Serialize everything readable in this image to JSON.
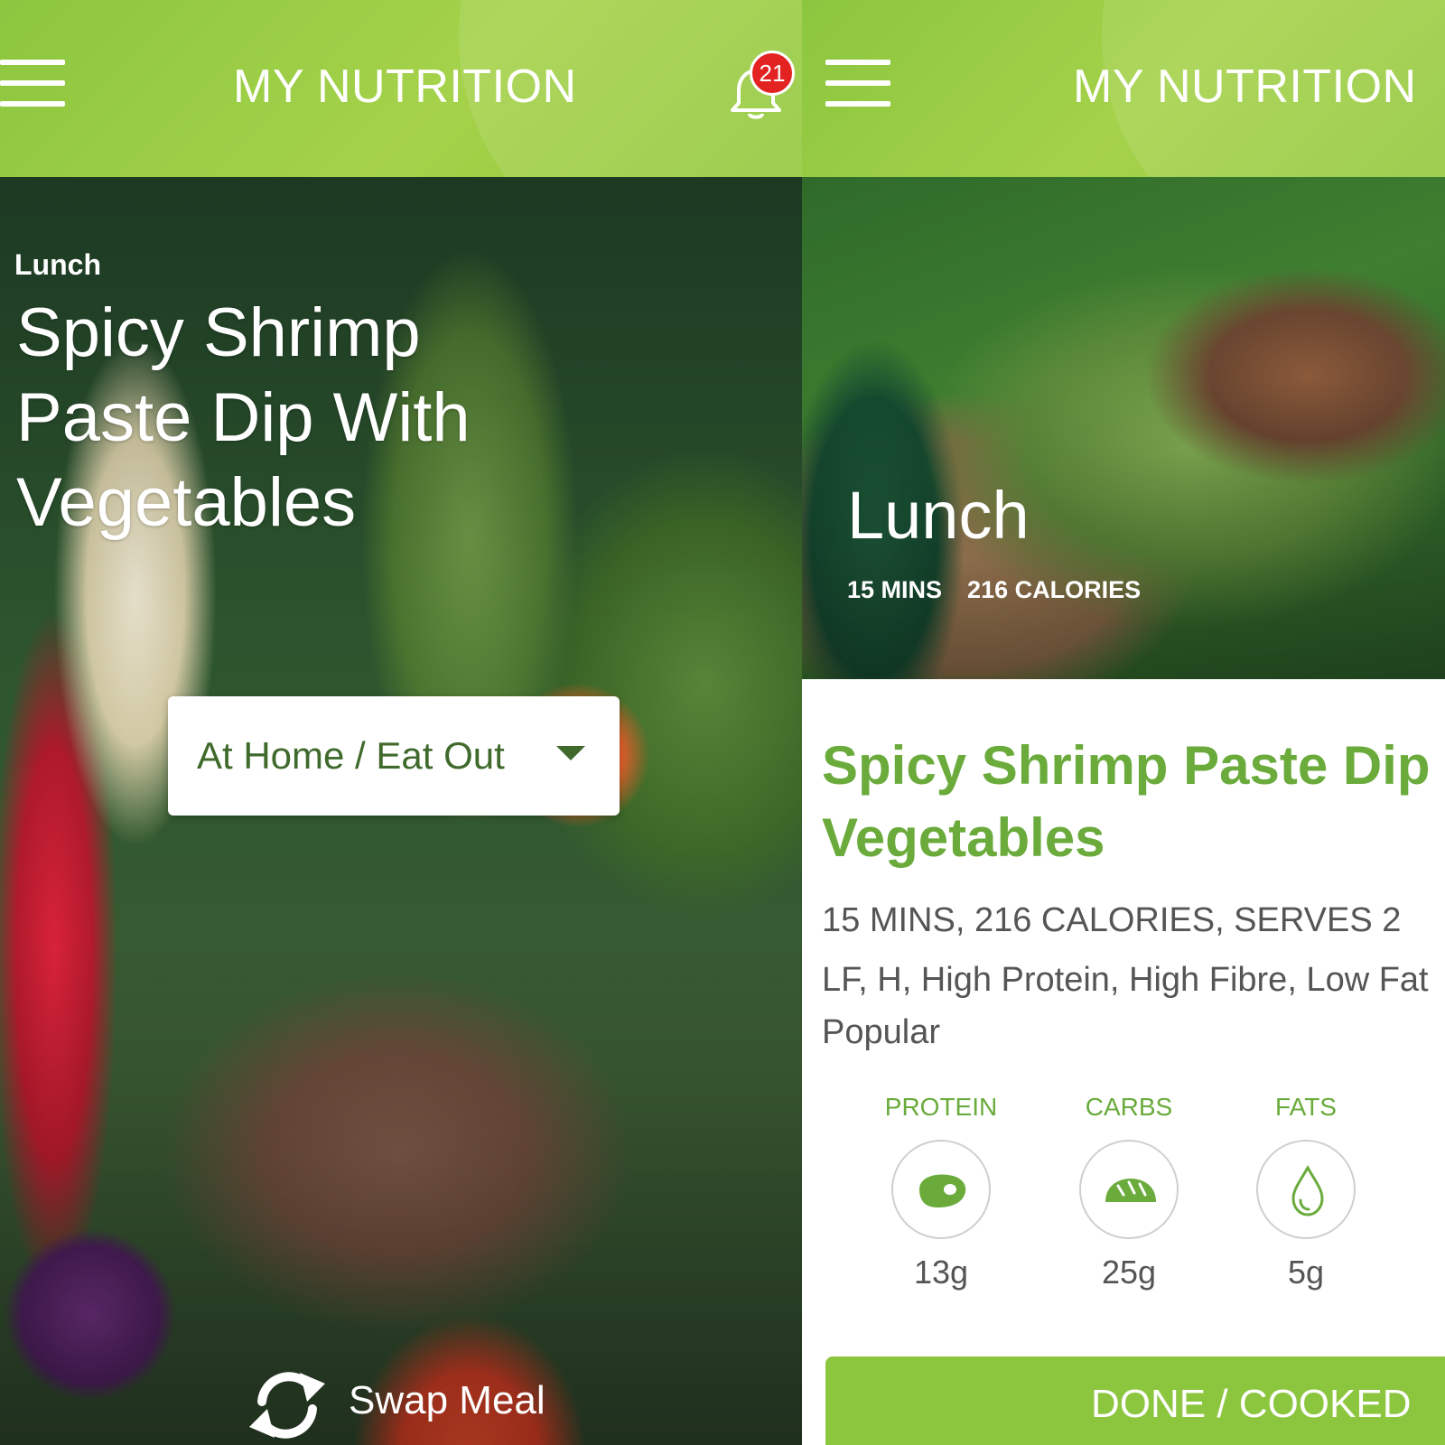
{
  "left_screen": {
    "header": {
      "title": "MY NUTRITION",
      "notification_count": "21"
    },
    "meal_type": "Lunch",
    "meal_title_lines": [
      "Spicy Shrimp",
      "Paste Dip With",
      "Vegetables"
    ],
    "dropdown": {
      "selected": "At Home / Eat Out"
    },
    "swap_label": "Swap Meal"
  },
  "right_screen": {
    "header": {
      "title": "MY NUTRITION"
    },
    "hero": {
      "meal_type": "Lunch",
      "time": "15 MINS",
      "calories": "216 CALORIES"
    },
    "detail": {
      "title_lines": [
        "Spicy Shrimp Paste Dip",
        "Vegetables"
      ],
      "meta": "15 MINS, 216 CALORIES, SERVES 2",
      "tags_line1": "LF, H, High Protein, High Fibre, Low Fat",
      "tags_line2": "Popular"
    },
    "macros": [
      {
        "label": "PROTEIN",
        "value": "13g",
        "icon": "steak-icon"
      },
      {
        "label": "CARBS",
        "value": "25g",
        "icon": "bread-icon"
      },
      {
        "label": "FATS",
        "value": "5g",
        "icon": "drop-icon"
      }
    ],
    "done_label": "DONE / COOKED"
  },
  "colors": {
    "header_green": "#8cc63f",
    "title_green": "#6aab3c",
    "badge_red": "#e32222",
    "dropdown_text": "#3f6a2c"
  }
}
